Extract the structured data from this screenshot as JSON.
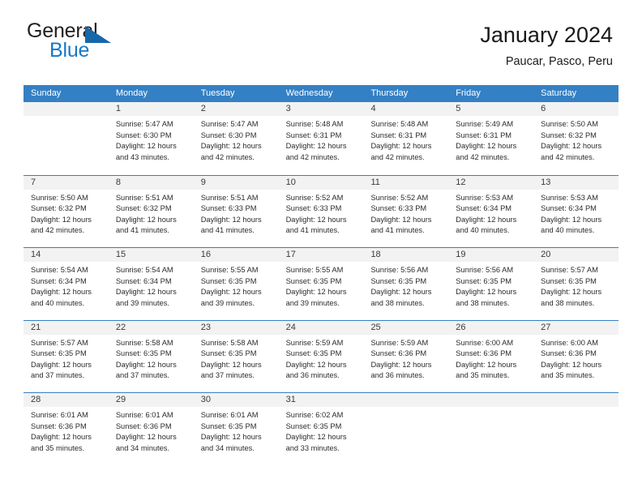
{
  "logo": {
    "word1": "General",
    "word2": "Blue",
    "triangle_icon": "triangle-icon",
    "accent_color": "#1878c4"
  },
  "header": {
    "title": "January 2024",
    "subtitle": "Paucar, Pasco, Peru"
  },
  "calendar": {
    "header_color": "#3480c4",
    "day_strip_color": "#f2f2f2",
    "weekdays": [
      "Sunday",
      "Monday",
      "Tuesday",
      "Wednesday",
      "Thursday",
      "Friday",
      "Saturday"
    ],
    "weeks": [
      [
        {
          "date": "",
          "lines": []
        },
        {
          "date": "1",
          "lines": [
            "Sunrise: 5:47 AM",
            "Sunset: 6:30 PM",
            "Daylight: 12 hours",
            "and 43 minutes."
          ]
        },
        {
          "date": "2",
          "lines": [
            "Sunrise: 5:47 AM",
            "Sunset: 6:30 PM",
            "Daylight: 12 hours",
            "and 42 minutes."
          ]
        },
        {
          "date": "3",
          "lines": [
            "Sunrise: 5:48 AM",
            "Sunset: 6:31 PM",
            "Daylight: 12 hours",
            "and 42 minutes."
          ]
        },
        {
          "date": "4",
          "lines": [
            "Sunrise: 5:48 AM",
            "Sunset: 6:31 PM",
            "Daylight: 12 hours",
            "and 42 minutes."
          ]
        },
        {
          "date": "5",
          "lines": [
            "Sunrise: 5:49 AM",
            "Sunset: 6:31 PM",
            "Daylight: 12 hours",
            "and 42 minutes."
          ]
        },
        {
          "date": "6",
          "lines": [
            "Sunrise: 5:50 AM",
            "Sunset: 6:32 PM",
            "Daylight: 12 hours",
            "and 42 minutes."
          ]
        }
      ],
      [
        {
          "date": "7",
          "lines": [
            "Sunrise: 5:50 AM",
            "Sunset: 6:32 PM",
            "Daylight: 12 hours",
            "and 42 minutes."
          ]
        },
        {
          "date": "8",
          "lines": [
            "Sunrise: 5:51 AM",
            "Sunset: 6:32 PM",
            "Daylight: 12 hours",
            "and 41 minutes."
          ]
        },
        {
          "date": "9",
          "lines": [
            "Sunrise: 5:51 AM",
            "Sunset: 6:33 PM",
            "Daylight: 12 hours",
            "and 41 minutes."
          ]
        },
        {
          "date": "10",
          "lines": [
            "Sunrise: 5:52 AM",
            "Sunset: 6:33 PM",
            "Daylight: 12 hours",
            "and 41 minutes."
          ]
        },
        {
          "date": "11",
          "lines": [
            "Sunrise: 5:52 AM",
            "Sunset: 6:33 PM",
            "Daylight: 12 hours",
            "and 41 minutes."
          ]
        },
        {
          "date": "12",
          "lines": [
            "Sunrise: 5:53 AM",
            "Sunset: 6:34 PM",
            "Daylight: 12 hours",
            "and 40 minutes."
          ]
        },
        {
          "date": "13",
          "lines": [
            "Sunrise: 5:53 AM",
            "Sunset: 6:34 PM",
            "Daylight: 12 hours",
            "and 40 minutes."
          ]
        }
      ],
      [
        {
          "date": "14",
          "lines": [
            "Sunrise: 5:54 AM",
            "Sunset: 6:34 PM",
            "Daylight: 12 hours",
            "and 40 minutes."
          ]
        },
        {
          "date": "15",
          "lines": [
            "Sunrise: 5:54 AM",
            "Sunset: 6:34 PM",
            "Daylight: 12 hours",
            "and 39 minutes."
          ]
        },
        {
          "date": "16",
          "lines": [
            "Sunrise: 5:55 AM",
            "Sunset: 6:35 PM",
            "Daylight: 12 hours",
            "and 39 minutes."
          ]
        },
        {
          "date": "17",
          "lines": [
            "Sunrise: 5:55 AM",
            "Sunset: 6:35 PM",
            "Daylight: 12 hours",
            "and 39 minutes."
          ]
        },
        {
          "date": "18",
          "lines": [
            "Sunrise: 5:56 AM",
            "Sunset: 6:35 PM",
            "Daylight: 12 hours",
            "and 38 minutes."
          ]
        },
        {
          "date": "19",
          "lines": [
            "Sunrise: 5:56 AM",
            "Sunset: 6:35 PM",
            "Daylight: 12 hours",
            "and 38 minutes."
          ]
        },
        {
          "date": "20",
          "lines": [
            "Sunrise: 5:57 AM",
            "Sunset: 6:35 PM",
            "Daylight: 12 hours",
            "and 38 minutes."
          ]
        }
      ],
      [
        {
          "date": "21",
          "lines": [
            "Sunrise: 5:57 AM",
            "Sunset: 6:35 PM",
            "Daylight: 12 hours",
            "and 37 minutes."
          ]
        },
        {
          "date": "22",
          "lines": [
            "Sunrise: 5:58 AM",
            "Sunset: 6:35 PM",
            "Daylight: 12 hours",
            "and 37 minutes."
          ]
        },
        {
          "date": "23",
          "lines": [
            "Sunrise: 5:58 AM",
            "Sunset: 6:35 PM",
            "Daylight: 12 hours",
            "and 37 minutes."
          ]
        },
        {
          "date": "24",
          "lines": [
            "Sunrise: 5:59 AM",
            "Sunset: 6:35 PM",
            "Daylight: 12 hours",
            "and 36 minutes."
          ]
        },
        {
          "date": "25",
          "lines": [
            "Sunrise: 5:59 AM",
            "Sunset: 6:36 PM",
            "Daylight: 12 hours",
            "and 36 minutes."
          ]
        },
        {
          "date": "26",
          "lines": [
            "Sunrise: 6:00 AM",
            "Sunset: 6:36 PM",
            "Daylight: 12 hours",
            "and 35 minutes."
          ]
        },
        {
          "date": "27",
          "lines": [
            "Sunrise: 6:00 AM",
            "Sunset: 6:36 PM",
            "Daylight: 12 hours",
            "and 35 minutes."
          ]
        }
      ],
      [
        {
          "date": "28",
          "lines": [
            "Sunrise: 6:01 AM",
            "Sunset: 6:36 PM",
            "Daylight: 12 hours",
            "and 35 minutes."
          ]
        },
        {
          "date": "29",
          "lines": [
            "Sunrise: 6:01 AM",
            "Sunset: 6:36 PM",
            "Daylight: 12 hours",
            "and 34 minutes."
          ]
        },
        {
          "date": "30",
          "lines": [
            "Sunrise: 6:01 AM",
            "Sunset: 6:35 PM",
            "Daylight: 12 hours",
            "and 34 minutes."
          ]
        },
        {
          "date": "31",
          "lines": [
            "Sunrise: 6:02 AM",
            "Sunset: 6:35 PM",
            "Daylight: 12 hours",
            "and 33 minutes."
          ]
        },
        {
          "date": "",
          "lines": []
        },
        {
          "date": "",
          "lines": []
        },
        {
          "date": "",
          "lines": []
        }
      ]
    ]
  }
}
